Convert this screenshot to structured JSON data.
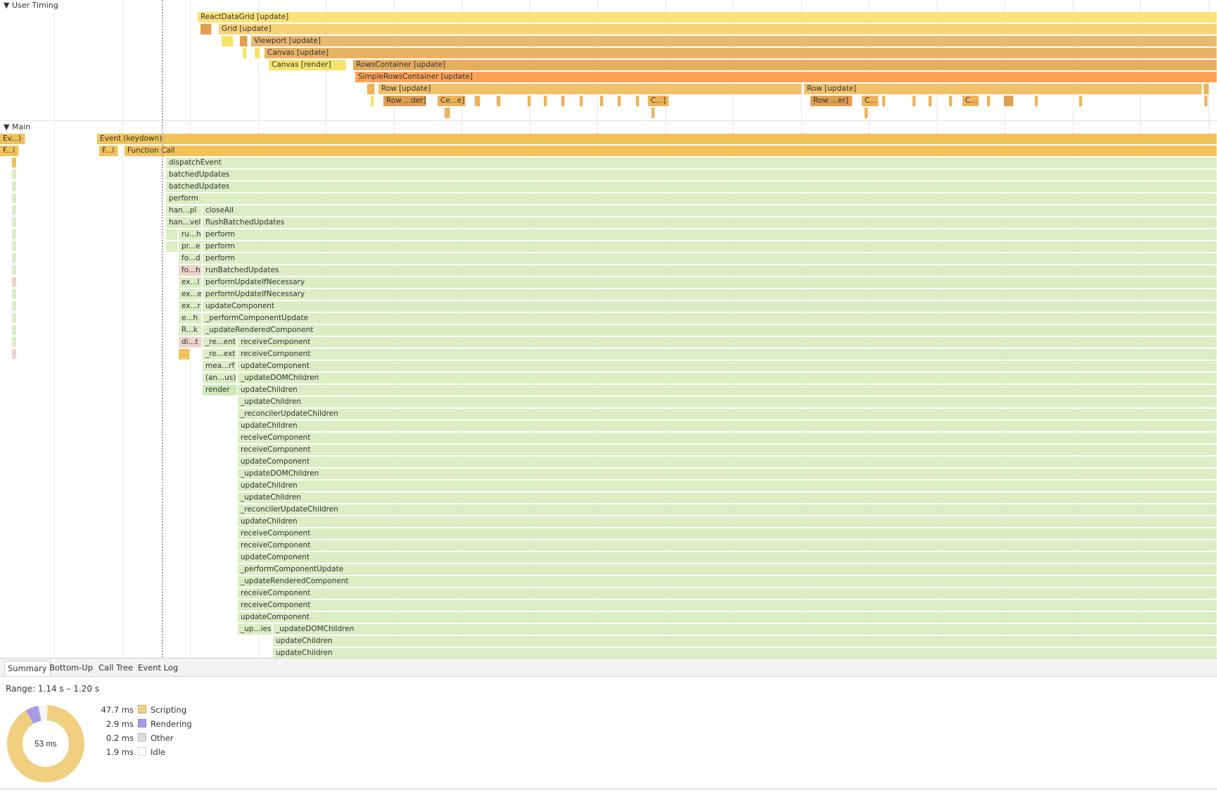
{
  "sections": {
    "user_timing": "User Timing",
    "main": "Main"
  },
  "user_timing": {
    "row0": {
      "reactdatagrid": "ReactDataGrid [update]"
    },
    "row1": {
      "grid": "Grid [update]"
    },
    "row2": {
      "viewport": "Viewport [update]"
    },
    "row3": {
      "canvas_update": "Canvas [update]"
    },
    "row4": {
      "canvas_render": "Canvas [render]",
      "rows_container": "RowsContainer [update]"
    },
    "row5": {
      "simple_rows": "SimpleRowsContainer [update]"
    },
    "row6": {
      "row_a": "Row [update]",
      "row_b": "Row [update]"
    },
    "row7": {
      "row_der": "Row ...der]",
      "ce": "Ce...e]",
      "c1": "C...]",
      "row_er": "Row ...er]",
      "c2": "C...",
      "c3": "C..."
    }
  },
  "main": {
    "ev_short": "Ev...)",
    "event_keydown": "Event (keydown)",
    "f_short": "F...l",
    "f_short2": "F...l",
    "function_call": "Function Call",
    "calls": {
      "dispatch": "dispatchEvent",
      "batched1": "batchedUpdates",
      "batched2": "batchedUpdates",
      "perform": "perform",
      "hanpl": "han...pl",
      "closeall": "closeAll",
      "hanvel": "han...vel",
      "flush": "flushBatchedUpdates",
      "ruh": "ru...h",
      "perform2": "perform",
      "pre": "pr...e",
      "perform3": "perform",
      "fod": "fo...d",
      "perform4": "perform",
      "foh": "fo...h",
      "runbatched": "runBatchedUpdates",
      "exl": "ex...l",
      "pui1": "performUpdateIfNecessary",
      "exe": "ex...e",
      "pui2": "performUpdateIfNecessary",
      "exr": "ex...r",
      "updatecomp1": "updateComponent",
      "eh": "e...h",
      "perfcompupd": "_performComponentUpdate",
      "rk": "R...k",
      "updrendered": "_updateRenderedComponent",
      "dit": "di...t",
      "reent": "_re...ent",
      "recv1": "receiveComponent",
      "reext": "_re...ext",
      "recv2": "receiveComponent",
      "mearf": "mea...rf",
      "updatecomp2": "updateComponent",
      "anus": "(an...us)",
      "upddom1": "_updateDOMChildren",
      "render": "render",
      "updchildren1": "updateChildren"
    },
    "deep": [
      "_updateChildren",
      "_reconcilerUpdateChildren",
      "updateChildren",
      "receiveComponent",
      "receiveComponent",
      "updateComponent",
      "_updateDOMChildren",
      "updateChildren",
      "_updateChildren",
      "_reconcilerUpdateChildren",
      "updateChildren",
      "receiveComponent",
      "receiveComponent",
      "updateComponent",
      "_performComponentUpdate",
      "_updateRenderedComponent",
      "receiveComponent",
      "receiveComponent",
      "updateComponent"
    ],
    "tail": {
      "upies": "_up...ies",
      "upddom2": "_updateDOMChildren",
      "updchildren2": "updateChildren",
      "updchildren3": "updateChildren"
    }
  },
  "details": {
    "tabs": [
      "Summary",
      "Bottom-Up",
      "Call Tree",
      "Event Log"
    ],
    "range": "Range: 1.14 s – 1.20 s",
    "total": "53 ms",
    "legend": [
      {
        "value": "47.7 ms",
        "label": "Scripting",
        "color": "#f0d080"
      },
      {
        "value": "2.9 ms",
        "label": "Rendering",
        "color": "#a99ae8"
      },
      {
        "value": "0.2 ms",
        "label": "Other",
        "color": "#dcdcdc"
      },
      {
        "value": "1.9 ms",
        "label": "Idle",
        "color": "#ffffff"
      }
    ]
  }
}
